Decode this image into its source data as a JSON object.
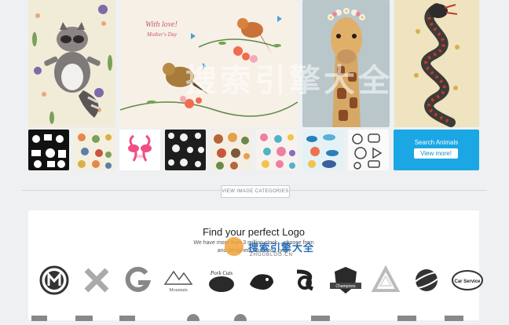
{
  "gallery": {
    "card_title": "With love!",
    "card_subtitle": "Mother's Day"
  },
  "search_card": {
    "title": "Search Animals",
    "button": "View more!",
    "color": "#1aa7e3"
  },
  "categories_button": "VIEW IMAGE CATEGORIES",
  "logo_section": {
    "title": "Find your perfect Logo",
    "line1": "We have more than 3 million stock... choose from",
    "line2": "and designers on-hand... you.",
    "logos": [
      "Mountain",
      "Pork Cuts",
      "Champions",
      "Car Service"
    ]
  },
  "watermark": {
    "main": "搜索引擎大全",
    "url": "ZHOUBLOG.CN"
  }
}
